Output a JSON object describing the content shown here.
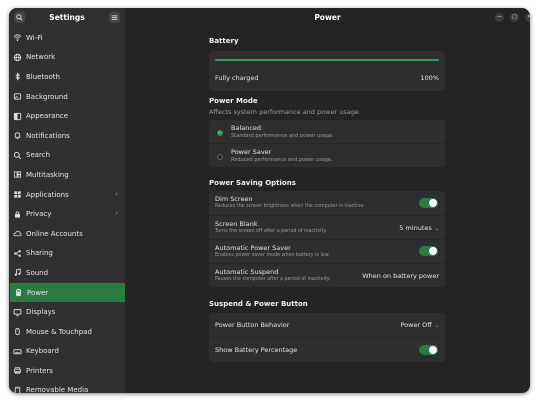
{
  "sidebar": {
    "title": "Settings",
    "items": [
      {
        "label": "Wi-Fi",
        "icon": "wifi-icon",
        "chevron": false
      },
      {
        "label": "Network",
        "icon": "network-icon",
        "chevron": false
      },
      {
        "label": "Bluetooth",
        "icon": "bluetooth-icon",
        "chevron": false
      },
      {
        "label": "Background",
        "icon": "background-icon",
        "chevron": false
      },
      {
        "label": "Appearance",
        "icon": "appearance-icon",
        "chevron": false
      },
      {
        "label": "Notifications",
        "icon": "bell-icon",
        "chevron": false
      },
      {
        "label": "Search",
        "icon": "search-icon",
        "chevron": false
      },
      {
        "label": "Multitasking",
        "icon": "multitasking-icon",
        "chevron": false
      },
      {
        "label": "Applications",
        "icon": "applications-icon",
        "chevron": true
      },
      {
        "label": "Privacy",
        "icon": "privacy-icon",
        "chevron": true
      },
      {
        "label": "Online Accounts",
        "icon": "online-accounts-icon",
        "chevron": false
      },
      {
        "label": "Sharing",
        "icon": "sharing-icon",
        "chevron": false
      },
      {
        "label": "Sound",
        "icon": "sound-icon",
        "chevron": false
      },
      {
        "label": "Power",
        "icon": "power-icon",
        "chevron": false,
        "active": true
      },
      {
        "label": "Displays",
        "icon": "displays-icon",
        "chevron": false
      },
      {
        "label": "Mouse & Touchpad",
        "icon": "mouse-icon",
        "chevron": false
      },
      {
        "label": "Keyboard",
        "icon": "keyboard-icon",
        "chevron": false
      },
      {
        "label": "Printers",
        "icon": "printer-icon",
        "chevron": false
      },
      {
        "label": "Removable Media",
        "icon": "removable-media-icon",
        "chevron": false
      }
    ]
  },
  "header": {
    "title": "Power"
  },
  "battery": {
    "section": "Battery",
    "status": "Fully charged",
    "percent_label": "100%",
    "level": 1.0
  },
  "power_mode": {
    "section": "Power Mode",
    "subtitle": "Affects system performance and power usage.",
    "options": [
      {
        "label": "Balanced",
        "desc": "Standard performance and power usage.",
        "selected": true
      },
      {
        "label": "Power Saver",
        "desc": "Reduced performance and power usage.",
        "selected": false
      }
    ]
  },
  "power_saving": {
    "section": "Power Saving Options",
    "dim_screen": {
      "label": "Dim Screen",
      "desc": "Reduces the screen brightness when the computer is inactive.",
      "on": true
    },
    "screen_blank": {
      "label": "Screen Blank",
      "desc": "Turns the screen off after a period of inactivity.",
      "value": "5 minutes"
    },
    "auto_power_saver": {
      "label": "Automatic Power Saver",
      "desc": "Enables power saver mode when battery is low.",
      "on": true
    },
    "auto_suspend": {
      "label": "Automatic Suspend",
      "desc": "Pauses the computer after a period of inactivity.",
      "value": "When on battery power"
    }
  },
  "suspend": {
    "section": "Suspend & Power Button",
    "power_button": {
      "label": "Power Button Behavior",
      "value": "Power Off"
    },
    "battery_pct": {
      "label": "Show Battery Percentage",
      "on": true
    }
  },
  "colors": {
    "accent": "#2a7a43",
    "window": "#242424",
    "sidebar": "#303030",
    "card": "#2e2e2e"
  }
}
